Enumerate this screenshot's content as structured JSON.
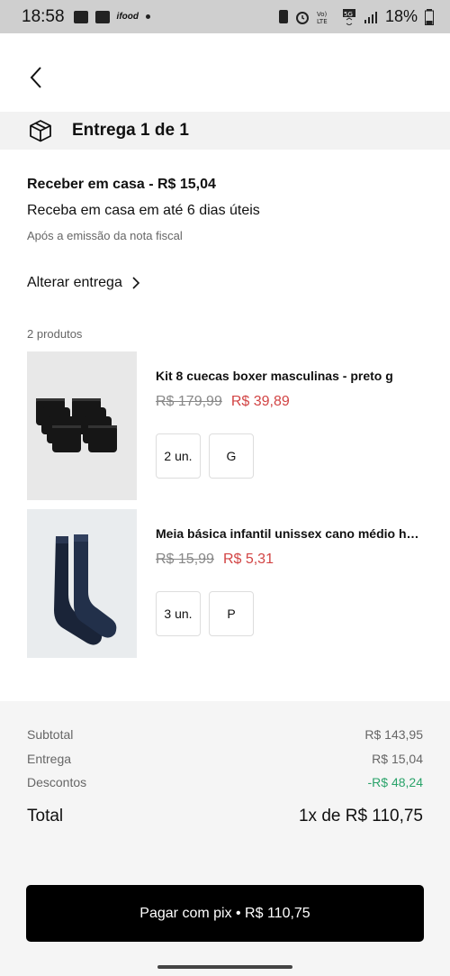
{
  "status": {
    "time": "18:58",
    "battery": "18%",
    "app_tag": "ifood"
  },
  "header": {
    "delivery_title": "Entrega 1 de 1"
  },
  "shipping": {
    "title": "Receber em casa - R$ 15,04",
    "subtitle": "Receba em casa em até 6 dias úteis",
    "note": "Após a emissão da nota fiscal",
    "change_label": "Alterar entrega"
  },
  "products_count": "2 produtos",
  "products": [
    {
      "name": "Kit 8 cuecas boxer masculinas - preto g",
      "old_price": "R$ 179,99",
      "price": "R$ 39,89",
      "qty": "2 un.",
      "size": "G"
    },
    {
      "name": "Meia básica infantil unissex cano médio her...",
      "old_price": "R$ 15,99",
      "price": "R$ 5,31",
      "qty": "3 un.",
      "size": "P"
    }
  ],
  "summary": {
    "subtotal_label": "Subtotal",
    "subtotal_value": "R$ 143,95",
    "delivery_label": "Entrega",
    "delivery_value": "R$ 15,04",
    "discount_label": "Descontos",
    "discount_value": "-R$ 48,24",
    "total_label": "Total",
    "total_value": "1x de R$ 110,75"
  },
  "pay_button": "Pagar com pix • R$ 110,75",
  "colors": {
    "accent_price": "#d24444",
    "discount": "#2aa36a",
    "button": "#000000"
  }
}
